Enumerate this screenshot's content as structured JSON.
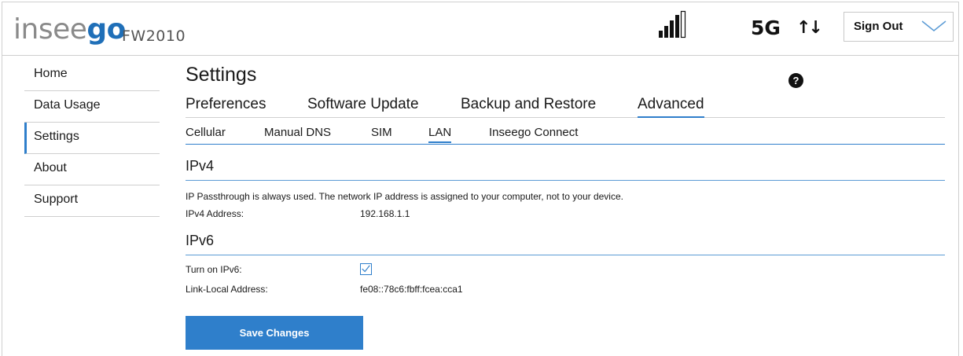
{
  "header": {
    "brand_prefix": "insee",
    "brand_suffix": "go",
    "model": "FW2010",
    "network": "5G",
    "traffic_arrows": "↑↓",
    "sign_out_label": "Sign Out",
    "signal_icon": "signal-bars-icon"
  },
  "sidebar": {
    "items": [
      {
        "label": "Home"
      },
      {
        "label": "Data Usage"
      },
      {
        "label": "Settings"
      },
      {
        "label": "About"
      },
      {
        "label": "Support"
      }
    ],
    "active": "Settings"
  },
  "main": {
    "title": "Settings",
    "help_glyph": "?",
    "tabs": [
      {
        "label": "Preferences"
      },
      {
        "label": "Software Update"
      },
      {
        "label": "Backup and Restore"
      },
      {
        "label": "Advanced"
      }
    ],
    "active_tab": "Advanced",
    "subtabs": [
      {
        "label": "Cellular"
      },
      {
        "label": "Manual DNS"
      },
      {
        "label": "SIM"
      },
      {
        "label": "LAN"
      },
      {
        "label": "Inseego Connect"
      }
    ],
    "active_subtab": "LAN"
  },
  "ipv4": {
    "heading": "IPv4",
    "note": "IP Passthrough is always used. The network IP address is assigned to your computer, not to your device.",
    "address_label": "IPv4 Address:",
    "address_value": "192.168.1.1"
  },
  "ipv6": {
    "heading": "IPv6",
    "enable_label": "Turn on IPv6:",
    "enabled": true,
    "link_local_label": "Link-Local Address:",
    "link_local_value": "fe08::78c6:fbff:fcea:cca1"
  },
  "save_label": "Save Changes",
  "colors": {
    "accent": "#2f7fcb",
    "brand_blue": "#1f6fb8"
  }
}
